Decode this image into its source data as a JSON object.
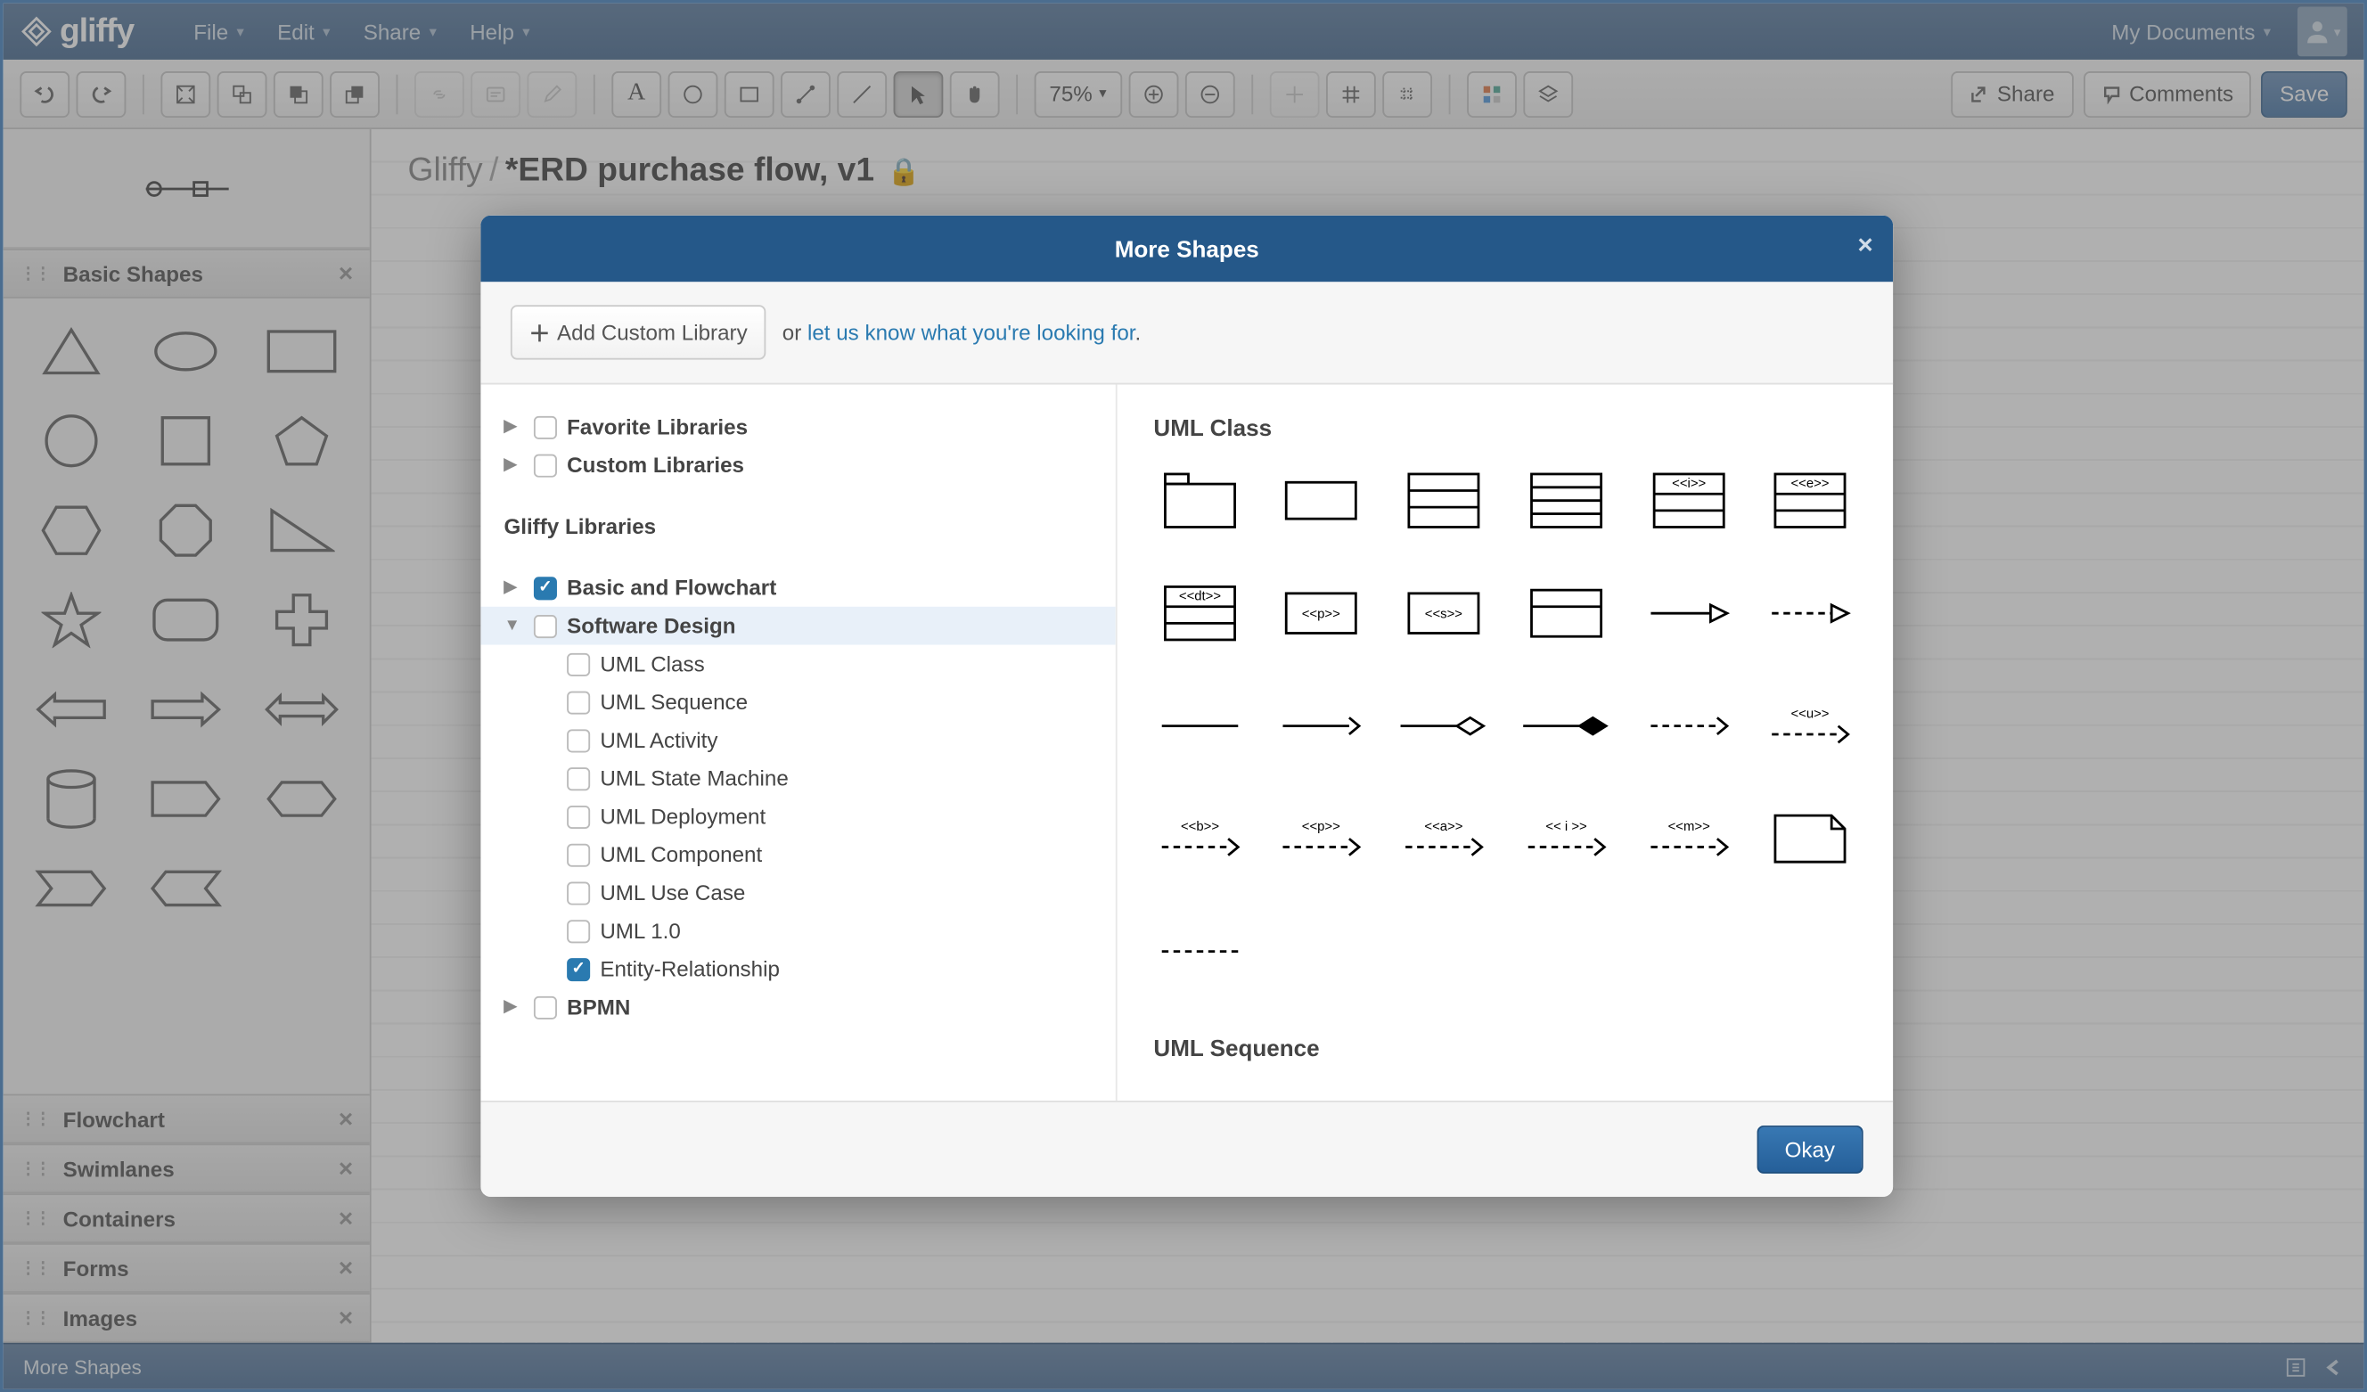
{
  "menubar": {
    "logo_text": "gliffy",
    "items": [
      "File",
      "Edit",
      "Share",
      "Help"
    ],
    "my_documents": "My Documents"
  },
  "toolbar": {
    "zoom": "75%",
    "share": "Share",
    "comments": "Comments",
    "save": "Save"
  },
  "sidebar": {
    "sections": {
      "basic_shapes": "Basic Shapes",
      "flowchart": "Flowchart",
      "swimlanes": "Swimlanes",
      "containers": "Containers",
      "forms": "Forms",
      "images": "Images"
    }
  },
  "breadcrumb": {
    "root": "Gliffy",
    "sep": "/",
    "current": "*ERD purchase flow, v1"
  },
  "bottombar": {
    "more_shapes": "More Shapes"
  },
  "modal": {
    "title": "More Shapes",
    "add_custom_library": "Add Custom Library",
    "or_text": "or ",
    "link_text": "let us know what you're looking for",
    "link_text_period": ".",
    "favorite_libraries": "Favorite Libraries",
    "custom_libraries": "Custom Libraries",
    "gliffy_libraries": "Gliffy Libraries",
    "tree": {
      "basic_flowchart": "Basic and Flowchart",
      "software_design": "Software Design",
      "uml_class": "UML Class",
      "uml_sequence": "UML Sequence",
      "uml_activity": "UML Activity",
      "uml_state_machine": "UML State Machine",
      "uml_deployment": "UML Deployment",
      "uml_component": "UML Component",
      "uml_use_case": "UML Use Case",
      "uml_10": "UML 1.0",
      "entity_relationship": "Entity-Relationship",
      "bpmn": "BPMN"
    },
    "preview": {
      "uml_class_title": "UML Class",
      "uml_sequence_title": "UML Sequence"
    },
    "okay": "Okay"
  }
}
